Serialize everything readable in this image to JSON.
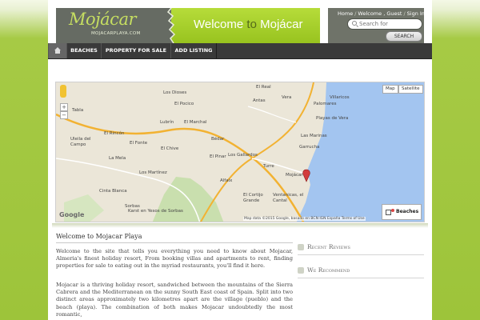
{
  "header": {
    "logo_text": "Mojácar",
    "logo_sub": "MOJACARPLAYA.COM",
    "welcome_prefix": "Welcome ",
    "welcome_to": "to",
    "welcome_suffix": " Mojácar"
  },
  "userbox": {
    "home": "Home",
    "welcome_guest": "Welcome , Guest",
    "sign_in": "Sign In",
    "search_placeholder": "Search for",
    "search_button": "SEARCH"
  },
  "nav": {
    "items": [
      "BEACHES",
      "PROPERTY FOR SALE",
      "ADD LISTING"
    ]
  },
  "map": {
    "map_button": "Map",
    "satellite_button": "Satellite",
    "legend_label": "Beaches",
    "attribution": "Map data ©2015 Google, basado en BCN IGN España   Terms of Use",
    "google_logo": "Google",
    "places": [
      "Vera",
      "El Real",
      "Los Dioses",
      "Antas",
      "Villaricos",
      "Palomares",
      "El Pocico",
      "Bédar",
      "Lubrín",
      "El Marchal",
      "Uleila del Campo",
      "El Rincón",
      "El Fonte",
      "El Chive",
      "La Mela",
      "Los Gallardos",
      "El Pinar",
      "Garrucha",
      "Las Marinas",
      "Playas de Vera",
      "Turre",
      "Mojácar",
      "Los Martínez",
      "Alfaix",
      "Cinta Blanca",
      "Sorbas",
      "El Cortijo Grande",
      "Ventanicas, el Cantal",
      "Karst en Yesos de Sorbas",
      "Tabla"
    ]
  },
  "content": {
    "title": "Welcome to Mojacar Playa",
    "paragraph1": "Welcome to the site that tells you everything you need to know about Mojacar, Almeria's finest holiday resort, From booking villas and apartments to rent, finding properties for sale to eating out in the myriad restaurants, you'll find it here.",
    "paragraph2": "Mojacar is a thriving holiday resort, sandwiched between the mountains of the Sierra Cabrera and the Mediterranean on the sunny South East coast of Spain. Split into two distinct areas approximately two kilometres apart are the village (pueblo) and the beach (playa). The combination of both makes Mojacar undoubtedly the most romantic,"
  },
  "sidebar": {
    "recent_reviews": "Recent Reviews",
    "we_recommend": "We Recommend"
  },
  "colors": {
    "background": "#9dc43a",
    "nav_bg": "#3a3a3a",
    "welcome_bar": "#a9d12d",
    "sea": "#a3c5f0"
  }
}
